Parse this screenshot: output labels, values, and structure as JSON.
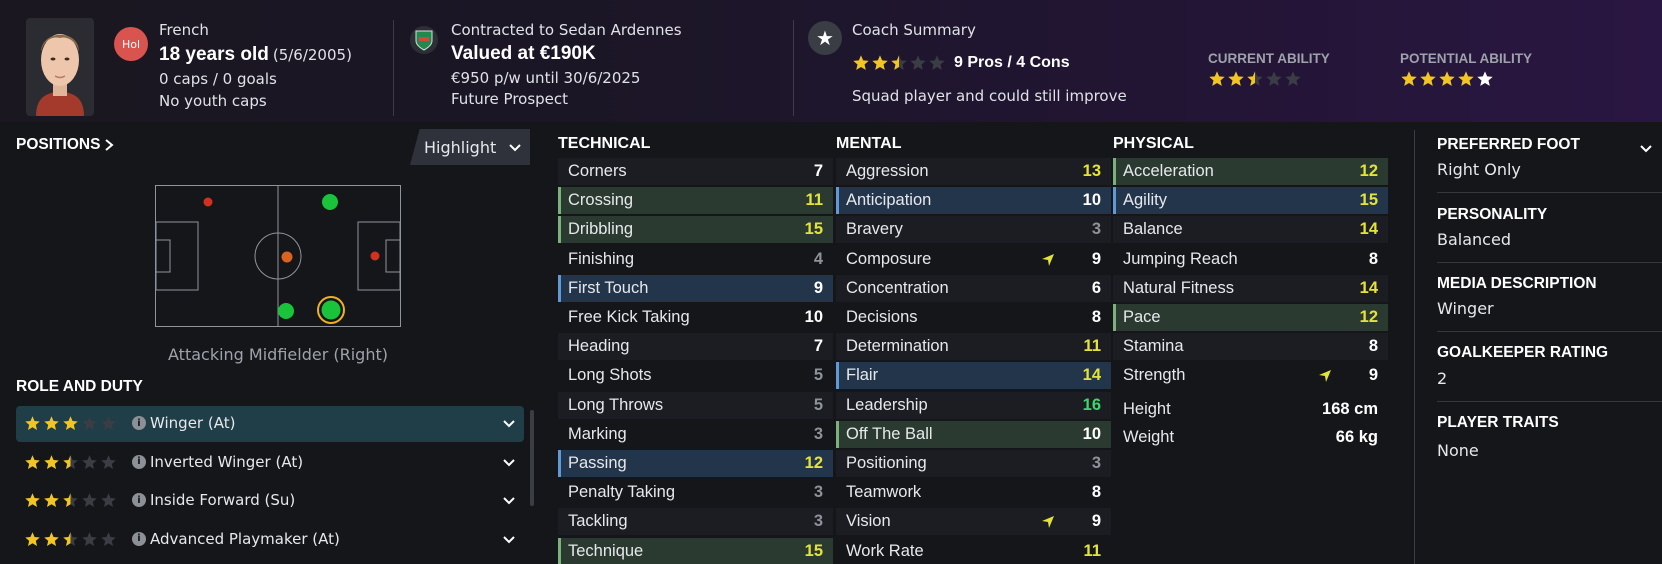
{
  "header": {
    "nationality": "French",
    "nationality_badge": "Hol",
    "age": "18 years old",
    "dob": "(5/6/2005)",
    "caps": "0 caps / 0 goals",
    "youth_caps": "No youth caps",
    "contract": "Contracted to Sedan Ardennes",
    "value": "Valued at €190K",
    "wage": "€950 p/w until 30/6/2025",
    "status": "Future Prospect",
    "coach_title": "Coach Summary",
    "coach_stars": 2.5,
    "pros_cons": "9 Pros / 4 Cons",
    "coach_text": "Squad player and could still improve",
    "current_ability_label": "CURRENT ABILITY",
    "current_ability_stars": 2.5,
    "potential_ability_label": "POTENTIAL ABILITY",
    "potential_ability_stars": 5
  },
  "positions": {
    "title": "POSITIONS",
    "highlight_button": "Highlight",
    "current_position": "Attacking Midfielder (Right)"
  },
  "role_duty": {
    "title": "ROLE AND DUTY",
    "roles": [
      {
        "label": "Winger (At)",
        "stars": 3
      },
      {
        "label": "Inverted Winger (At)",
        "stars": 2.5
      },
      {
        "label": "Inside Forward (Su)",
        "stars": 2.5
      },
      {
        "label": "Advanced Playmaker (At)",
        "stars": 2.5
      }
    ]
  },
  "technical": {
    "title": "TECHNICAL",
    "attrs": [
      {
        "name": "Corners",
        "value": "7"
      },
      {
        "name": "Crossing",
        "value": "11"
      },
      {
        "name": "Dribbling",
        "value": "15"
      },
      {
        "name": "Finishing",
        "value": "4"
      },
      {
        "name": "First Touch",
        "value": "9"
      },
      {
        "name": "Free Kick Taking",
        "value": "10"
      },
      {
        "name": "Heading",
        "value": "7"
      },
      {
        "name": "Long Shots",
        "value": "5"
      },
      {
        "name": "Long Throws",
        "value": "5"
      },
      {
        "name": "Marking",
        "value": "3"
      },
      {
        "name": "Passing",
        "value": "12"
      },
      {
        "name": "Penalty Taking",
        "value": "3"
      },
      {
        "name": "Tackling",
        "value": "3"
      },
      {
        "name": "Technique",
        "value": "15"
      }
    ]
  },
  "mental": {
    "title": "MENTAL",
    "attrs": [
      {
        "name": "Aggression",
        "value": "13"
      },
      {
        "name": "Anticipation",
        "value": "10"
      },
      {
        "name": "Bravery",
        "value": "3"
      },
      {
        "name": "Composure",
        "value": "9"
      },
      {
        "name": "Concentration",
        "value": "6"
      },
      {
        "name": "Decisions",
        "value": "8"
      },
      {
        "name": "Determination",
        "value": "11"
      },
      {
        "name": "Flair",
        "value": "14"
      },
      {
        "name": "Leadership",
        "value": "16"
      },
      {
        "name": "Off The Ball",
        "value": "10"
      },
      {
        "name": "Positioning",
        "value": "3"
      },
      {
        "name": "Teamwork",
        "value": "8"
      },
      {
        "name": "Vision",
        "value": "9"
      },
      {
        "name": "Work Rate",
        "value": "11"
      }
    ]
  },
  "physical": {
    "title": "PHYSICAL",
    "attrs": [
      {
        "name": "Acceleration",
        "value": "12"
      },
      {
        "name": "Agility",
        "value": "15"
      },
      {
        "name": "Balance",
        "value": "14"
      },
      {
        "name": "Jumping Reach",
        "value": "8"
      },
      {
        "name": "Natural Fitness",
        "value": "14"
      },
      {
        "name": "Pace",
        "value": "12"
      },
      {
        "name": "Stamina",
        "value": "8"
      },
      {
        "name": "Strength",
        "value": "9"
      }
    ],
    "height_label": "Height",
    "height": "168 cm",
    "weight_label": "Weight",
    "weight": "66 kg"
  },
  "details": {
    "preferred_foot_label": "PREFERRED FOOT",
    "preferred_foot": "Right Only",
    "personality_label": "PERSONALITY",
    "personality": "Balanced",
    "media_label": "MEDIA DESCRIPTION",
    "media": "Winger",
    "gk_label": "GOALKEEPER RATING",
    "gk": "2",
    "traits_label": "PLAYER TRAITS",
    "traits": "None"
  },
  "colors": {
    "accent_yellow": "#e4e33a",
    "accent_green": "#3fd46c",
    "star": "#f2c522"
  }
}
